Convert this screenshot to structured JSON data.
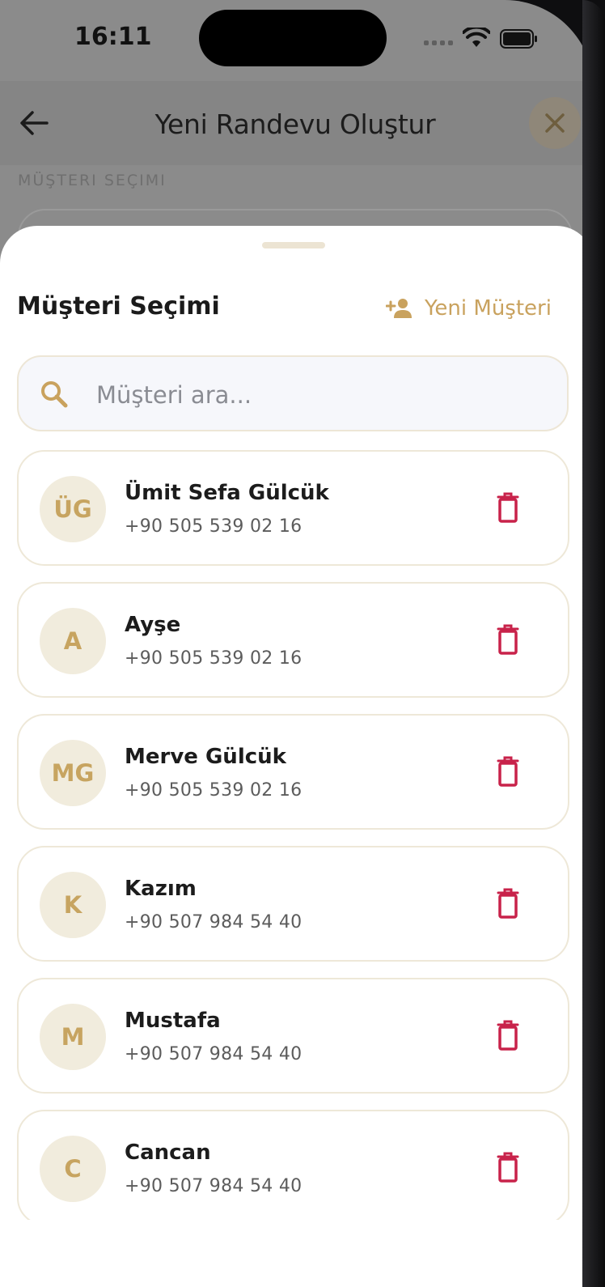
{
  "status": {
    "time": "16:11"
  },
  "header": {
    "title": "Yeni Randevu Oluştur"
  },
  "background_section": {
    "label": "MÜŞTERI SEÇIMI"
  },
  "sheet": {
    "title": "Müşteri Seçimi",
    "new_customer_label": "Yeni Müşteri",
    "search_placeholder": "Müşteri ara..."
  },
  "customers": [
    {
      "initials": "ÜG",
      "name": "Ümit Sefa Gülcük",
      "phone": "+90 505 539 02 16"
    },
    {
      "initials": "A",
      "name": "Ayşe",
      "phone": "+90 505 539 02 16"
    },
    {
      "initials": "MG",
      "name": "Merve Gülcük",
      "phone": "+90 505 539 02 16"
    },
    {
      "initials": "K",
      "name": "Kazım",
      "phone": "+90 507 984 54 40"
    },
    {
      "initials": "M",
      "name": "Mustafa",
      "phone": "+90 507 984 54 40"
    },
    {
      "initials": "C",
      "name": "Cancan",
      "phone": "+90 507 984 54 40"
    }
  ],
  "colors": {
    "accent": "#c9a25e",
    "delete": "#c8224a",
    "avatar_bg": "#f1ecdd"
  },
  "icons": {
    "back": "arrow-left-icon",
    "close": "close-icon",
    "add_person": "person-add-icon",
    "search": "search-icon",
    "delete": "trash-icon"
  }
}
